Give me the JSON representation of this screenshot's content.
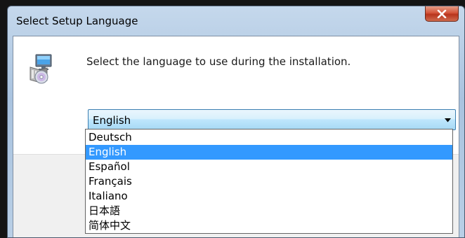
{
  "window": {
    "title": "Select Setup Language",
    "close_icon": "close-x-icon"
  },
  "dialog": {
    "icon": "setup-installer-icon",
    "prompt": "Select the language to use during the installation."
  },
  "language_select": {
    "selected": "English",
    "arrow_icon": "chevron-down-icon",
    "options": [
      {
        "label": "Deutsch",
        "selected": false
      },
      {
        "label": "English",
        "selected": true
      },
      {
        "label": "Español",
        "selected": false
      },
      {
        "label": "Français",
        "selected": false
      },
      {
        "label": "Italiano",
        "selected": false
      },
      {
        "label": "日本語",
        "selected": false
      },
      {
        "label": "简体中文",
        "selected": false
      }
    ]
  },
  "colors": {
    "selection_highlight": "#3399ff",
    "close_button": "#c8472b",
    "combo_border": "#3c7fb1"
  }
}
